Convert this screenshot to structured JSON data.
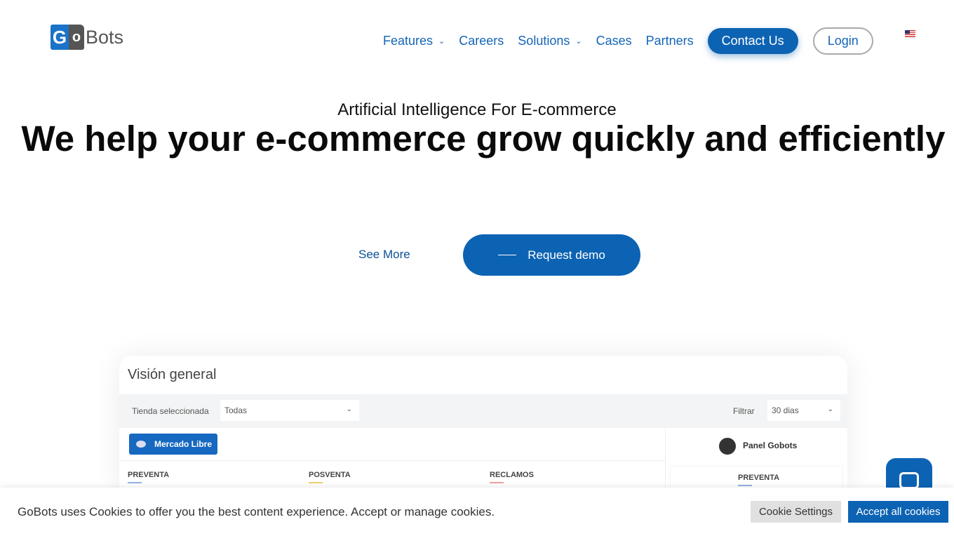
{
  "brand": {
    "logo_g": "G",
    "logo_o": "o",
    "logo_bots": "Bots"
  },
  "nav": {
    "items": [
      {
        "label": "Features",
        "dropdown": true
      },
      {
        "label": "Careers"
      },
      {
        "label": "Solutions",
        "dropdown": true
      },
      {
        "label": "Cases"
      },
      {
        "label": "Partners"
      }
    ],
    "contact": "Contact Us",
    "login": "Login",
    "language": "en-US flag"
  },
  "hero": {
    "subtitle": "Artificial Intelligence For E-commerce",
    "title": "We help your e-commerce grow quickly and efficiently",
    "see_more": "See More",
    "request_demo": "Request demo"
  },
  "dashboard": {
    "title": "Visión general",
    "store_label": "Tienda seleccionada",
    "store_value": "Todas",
    "filter_label": "Filtrar",
    "filter_value": "30 dias",
    "marketplace": "Mercado Libre",
    "panel": "Panel Gobots",
    "columns": [
      {
        "label": "PREVENTA",
        "color": "#8fb3e0"
      },
      {
        "label": "POSVENTA",
        "color": "#f0d070"
      },
      {
        "label": "RECLAMOS",
        "color": "#f0a0a0"
      }
    ],
    "side_label": "PREVENTA"
  },
  "cookie": {
    "text": "GoBots uses Cookies to offer you the best content experience. Accept or manage cookies.",
    "settings": "Cookie Settings",
    "accept": "Accept all cookies"
  },
  "colors": {
    "primary": "#0d63b3",
    "link": "#1565b8"
  }
}
